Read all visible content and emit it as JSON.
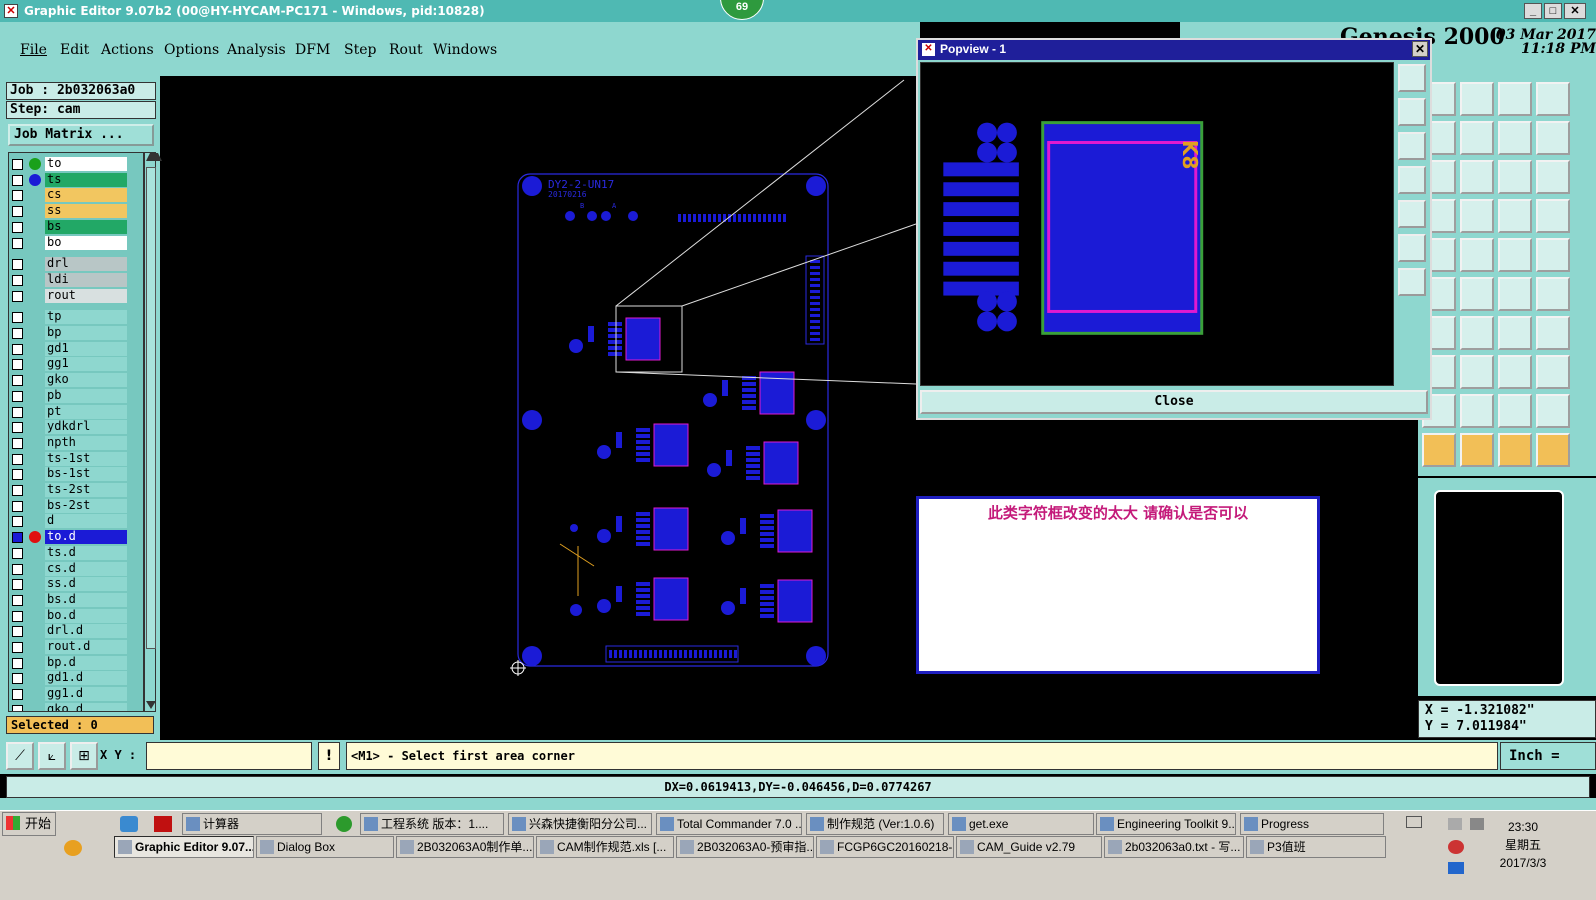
{
  "window": {
    "title": "Graphic Editor 9.07b2 (00@HY-HYCAM-PC171 - Windows, pid:10828)",
    "badge": "69",
    "min": "_",
    "max": "□",
    "close": "✕"
  },
  "menu": [
    "File",
    "Edit",
    "Actions",
    "Options",
    "Analysis",
    "DFM",
    "Step",
    "Rout",
    "Windows"
  ],
  "header_right": {
    "date": "03 Mar 2017",
    "time": "11:18 PM",
    "brand": "Genesis 2000"
  },
  "job": {
    "job_label": "Job : 2b032063a0",
    "step_label": "Step: cam",
    "matrix_button": "Job Matrix ..."
  },
  "layers": [
    {
      "name": "to",
      "bg": "#ffffff",
      "dot": "#1aa01a"
    },
    {
      "name": "ts",
      "bg": "#22a866",
      "dot": "#1b1bd6"
    },
    {
      "name": "cs",
      "bg": "#f2c660",
      "dot": ""
    },
    {
      "name": "ss",
      "bg": "#f2c660",
      "dot": ""
    },
    {
      "name": "bs",
      "bg": "#22a866",
      "dot": ""
    },
    {
      "name": "bo",
      "bg": "#ffffff",
      "dot": ""
    },
    {
      "name": "drl",
      "bg": "#b8c6c6",
      "dot": ""
    },
    {
      "name": "ldi",
      "bg": "#b8c6c6",
      "dot": ""
    },
    {
      "name": "rout",
      "bg": "#d8e0e0",
      "dot": ""
    },
    {
      "name": "tp",
      "bg": "#8ed7cf",
      "dot": ""
    },
    {
      "name": "bp",
      "bg": "#8ed7cf",
      "dot": ""
    },
    {
      "name": "gd1",
      "bg": "#8ed7cf",
      "dot": ""
    },
    {
      "name": "gg1",
      "bg": "#8ed7cf",
      "dot": ""
    },
    {
      "name": "gko",
      "bg": "#8ed7cf",
      "dot": ""
    },
    {
      "name": "pb",
      "bg": "#8ed7cf",
      "dot": ""
    },
    {
      "name": "pt",
      "bg": "#8ed7cf",
      "dot": ""
    },
    {
      "name": "ydkdrl",
      "bg": "#8ed7cf",
      "dot": ""
    },
    {
      "name": "npth",
      "bg": "#8ed7cf",
      "dot": ""
    },
    {
      "name": "ts-1st",
      "bg": "#8ed7cf",
      "dot": ""
    },
    {
      "name": "bs-1st",
      "bg": "#8ed7cf",
      "dot": ""
    },
    {
      "name": "ts-2st",
      "bg": "#8ed7cf",
      "dot": ""
    },
    {
      "name": "bs-2st",
      "bg": "#8ed7cf",
      "dot": ""
    },
    {
      "name": "d",
      "bg": "#8ed7cf",
      "dot": ""
    },
    {
      "name": "to.d",
      "bg": "#1b1bd6",
      "dot": "#e01010"
    },
    {
      "name": "ts.d",
      "bg": "#8ed7cf",
      "dot": ""
    },
    {
      "name": "cs.d",
      "bg": "#8ed7cf",
      "dot": ""
    },
    {
      "name": "ss.d",
      "bg": "#8ed7cf",
      "dot": ""
    },
    {
      "name": "bs.d",
      "bg": "#8ed7cf",
      "dot": ""
    },
    {
      "name": "bo.d",
      "bg": "#8ed7cf",
      "dot": ""
    },
    {
      "name": "drl.d",
      "bg": "#8ed7cf",
      "dot": ""
    },
    {
      "name": "rout.d",
      "bg": "#8ed7cf",
      "dot": ""
    },
    {
      "name": "bp.d",
      "bg": "#8ed7cf",
      "dot": ""
    },
    {
      "name": "gd1.d",
      "bg": "#8ed7cf",
      "dot": ""
    },
    {
      "name": "gg1.d",
      "bg": "#8ed7cf",
      "dot": ""
    },
    {
      "name": "gko.d",
      "bg": "#8ed7cf",
      "dot": ""
    }
  ],
  "selected": "Selected : 0",
  "board": {
    "label": "DY2-2-UN17",
    "date": "20170216",
    "markB": "B",
    "markA": "A"
  },
  "popview": {
    "title": "Popview - 1",
    "close_label": "Close",
    "part_label": "K8"
  },
  "note": "此类字符框改变的太大   请确认是否可以",
  "command": {
    "xy_label": "X Y :",
    "xy_value": "",
    "prompt": "<M1> - Select first area corner",
    "unit": "Inch ="
  },
  "status": "DX=0.0619413,DY=-0.046456,D=0.0774267",
  "coords": {
    "x": "X = -1.321082\"",
    "y": "Y = 7.011984\""
  },
  "taskbar": {
    "start": "开始",
    "row1": [
      "计算器",
      "工程系统  版本：1....",
      "兴森快捷衡阳分公司...",
      "Total Commander 7.0 ...",
      "制作规范 (Ver:1.0.6)",
      "get.exe",
      "Engineering Toolkit 9....",
      "Progress"
    ],
    "row2": [
      "Graphic Editor 9.07...",
      "Dialog Box",
      "2B032063A0制作单....",
      "CAM制作规范.xls  [...",
      "2B032063A0-预审指...",
      "FCGP6GC20160218-...",
      "CAM_Guide v2.79",
      "2b032063a0.txt - 写...",
      "P3值班"
    ],
    "clock": {
      "time": "23:30",
      "day": "星期五",
      "date": "2017/3/3"
    }
  },
  "colors": {
    "teal": "#8ed7cf",
    "pad_blue": "#1b1bd6",
    "outline_blue": "#2a2ae0",
    "magenta": "#e01ad0",
    "green": "#3aa03a"
  }
}
